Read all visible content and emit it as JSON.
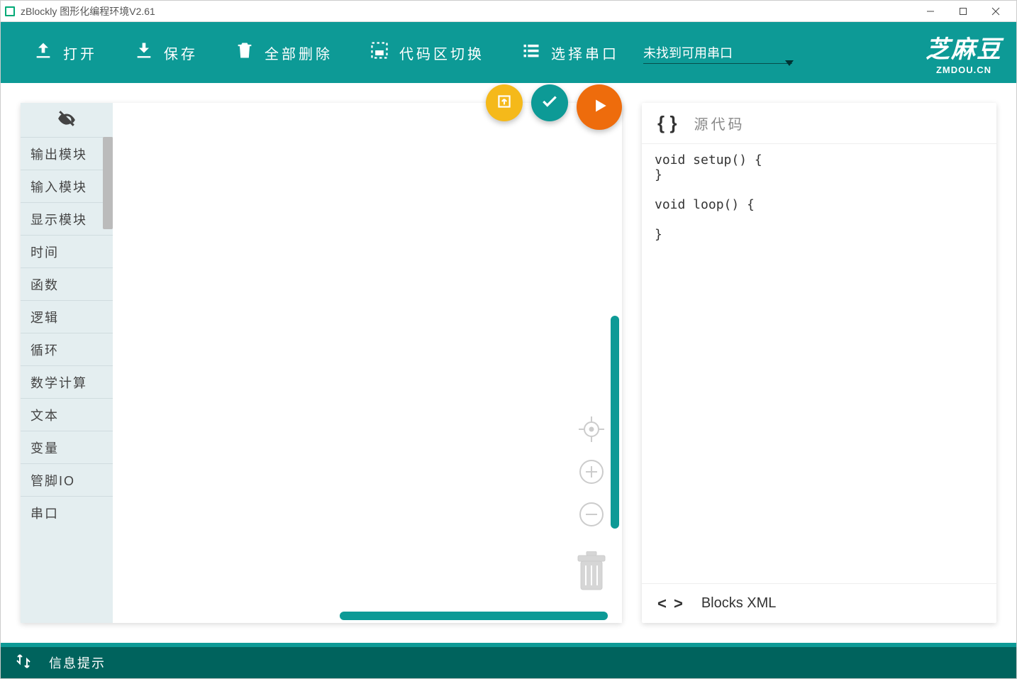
{
  "window": {
    "title": "zBlockly 图形化编程环境V2.61"
  },
  "toolbar": {
    "open": "打开",
    "save": "保存",
    "delete_all": "全部删除",
    "toggle_code": "代码区切换",
    "select_serial": "选择串口",
    "serial_status": "未找到可用串口"
  },
  "logo": {
    "line1": "芝麻豆",
    "line2": "ZMDOU.CN"
  },
  "categories": [
    "输出模块",
    "输入模块",
    "显示模块",
    "时间",
    "函数",
    "逻辑",
    "循环",
    "数学计算",
    "文本",
    "变量",
    "管脚IO",
    "串口"
  ],
  "code_panel": {
    "header_icon": "{ }",
    "header_label": "源代码",
    "code": "void setup() {\n}\n\nvoid loop() {\n\n}",
    "footer_icon": "< >",
    "footer_label": "Blocks XML"
  },
  "status": {
    "label": "信息提示"
  }
}
